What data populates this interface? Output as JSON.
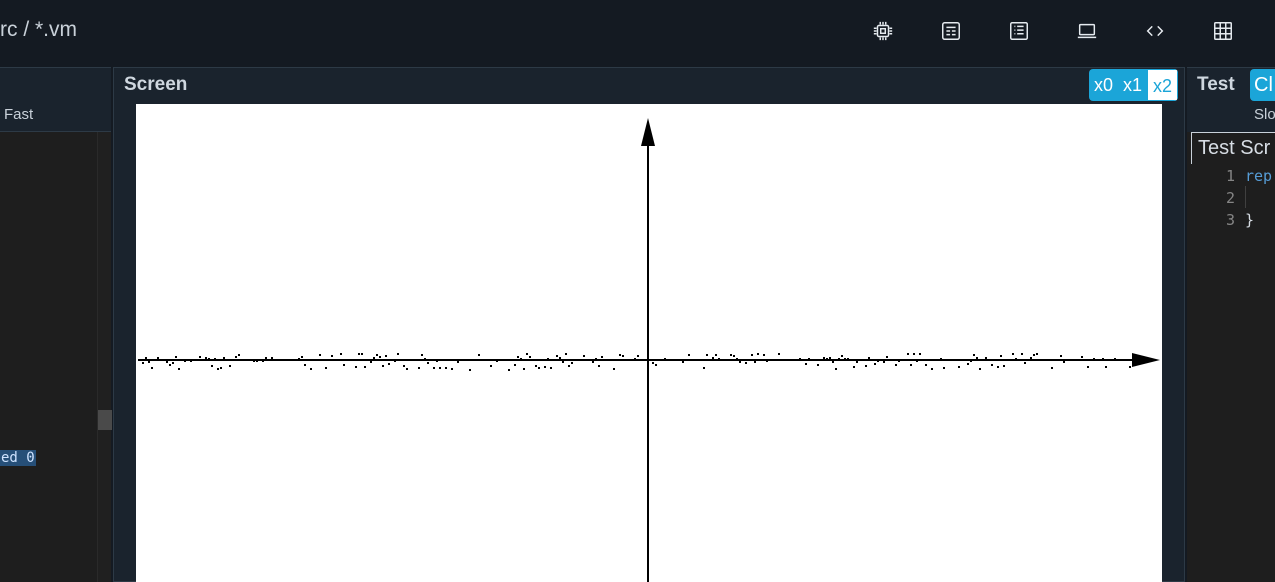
{
  "header": {
    "path": "rc / *.vm"
  },
  "toolbar": {
    "icons": [
      "chip-icon",
      "board-icon",
      "list-icon",
      "laptop-icon",
      "code-icon",
      "grid-icon"
    ]
  },
  "vm_panel": {
    "speed_label": "Fast",
    "code_fragment": "ed 0"
  },
  "screen_panel": {
    "title": "Screen",
    "scale_options": [
      "x0",
      "x1",
      "x2"
    ],
    "selected_scale": "x2",
    "plot": {
      "background": "#ffffff",
      "foreground": "#000000"
    }
  },
  "test_panel": {
    "title": "Test",
    "clear_label": "Cl",
    "speed_label": "Slo",
    "tab_label": "Test Scr",
    "lines": [
      {
        "num": "1",
        "text": "rep"
      },
      {
        "num": "2",
        "text": ""
      },
      {
        "num": "3",
        "text": "}"
      }
    ]
  },
  "colors": {
    "accent": "#1ba5d8",
    "topbar": "#141a22",
    "panel_header": "#1a232d",
    "editor_bg": "#1e1e1e",
    "selection": "#264f78",
    "keyword": "#569cd6"
  }
}
